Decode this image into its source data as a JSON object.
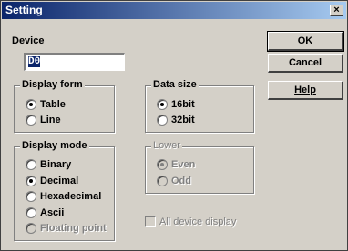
{
  "window": {
    "title": "Setting",
    "close_glyph": "×"
  },
  "device": {
    "label": "Device",
    "value": "D0"
  },
  "buttons": {
    "ok": "OK",
    "cancel": "Cancel",
    "help": "Help"
  },
  "display_form": {
    "title": "Display form",
    "options": [
      "Table",
      "Line"
    ],
    "selected": "Table"
  },
  "data_size": {
    "title": "Data size",
    "options": [
      "16bit",
      "32bit"
    ],
    "selected": "16bit"
  },
  "display_mode": {
    "title": "Display mode",
    "options": [
      "Binary",
      "Decimal",
      "Hexadecimal",
      "Ascii",
      "Floating point"
    ],
    "selected": "Decimal",
    "disabled": [
      "Floating point"
    ]
  },
  "lower": {
    "title": "Lower",
    "options": [
      "Even",
      "Odd"
    ],
    "selected": "Even",
    "disabled": true
  },
  "all_device_display": {
    "label": "All device display",
    "checked": false,
    "disabled": true
  }
}
